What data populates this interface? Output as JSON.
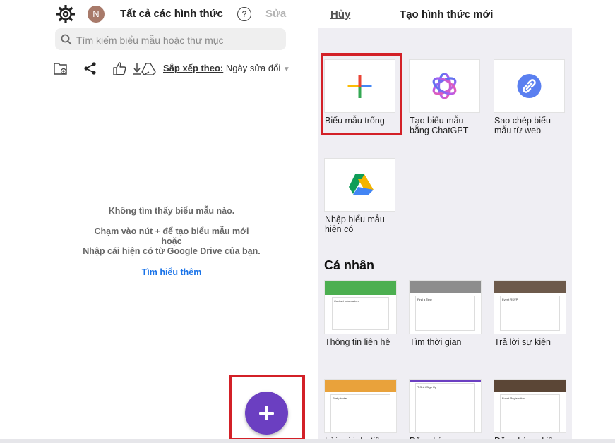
{
  "left": {
    "avatar_initial": "N",
    "title": "Tất cả các hình thức",
    "help": "?",
    "edit": "Sửa",
    "search_placeholder": "Tìm kiếm biểu mẫu hoặc thư mục",
    "sort_label": "Sắp xếp theo:",
    "sort_value": "Ngày sửa đổi",
    "empty_title": "Không tìm thấy biểu mẫu nào.",
    "empty_line1": "Chạm vào nút + để tạo biểu mẫu mới",
    "empty_line2": "hoặc",
    "empty_line3": "Nhập cái hiện có từ Google Drive của bạn.",
    "learn_more": "Tìm hiểu thêm",
    "fab_icon": "plus-icon"
  },
  "right": {
    "cancel": "Hủy",
    "title": "Tạo hình thức mới",
    "options": [
      {
        "line1": "Biểu mẫu trống",
        "line2": "",
        "icon": "plus-icon"
      },
      {
        "line1": "Tạo biểu mẫu",
        "line2": "bằng ChatGPT",
        "icon": "chatgpt-icon"
      },
      {
        "line1": "Sao chép biểu",
        "line2": "mẫu từ web",
        "icon": "link-icon"
      },
      {
        "line1": "Nhập biểu mẫu",
        "line2": "hiện có",
        "icon": "google-drive-icon"
      }
    ],
    "section_title": "Cá nhân",
    "templates": [
      {
        "label": "Thông tin liên hệ",
        "heading": "Contact information",
        "color": "#4caf50"
      },
      {
        "label": "Tìm thời gian",
        "heading": "Find a Time",
        "color": "#8d8d8d"
      },
      {
        "label": "Trả lời sự kiện",
        "heading": "Event RSVP",
        "color": "#6d5a4b"
      },
      {
        "label": "Lời mời dự tiệc",
        "heading": "Party Invite",
        "color": "#e9a23b"
      },
      {
        "label": "Đăng ký",
        "heading": "T-Shirt Sign Up",
        "color": "#6b3fc1"
      },
      {
        "label": "Đăng ký sự kiện",
        "heading": "Event Registration",
        "color": "#5b4636"
      }
    ]
  },
  "colors": {
    "accent": "#6b3fc1",
    "highlight": "#d32027",
    "link": "#1a73e8"
  }
}
